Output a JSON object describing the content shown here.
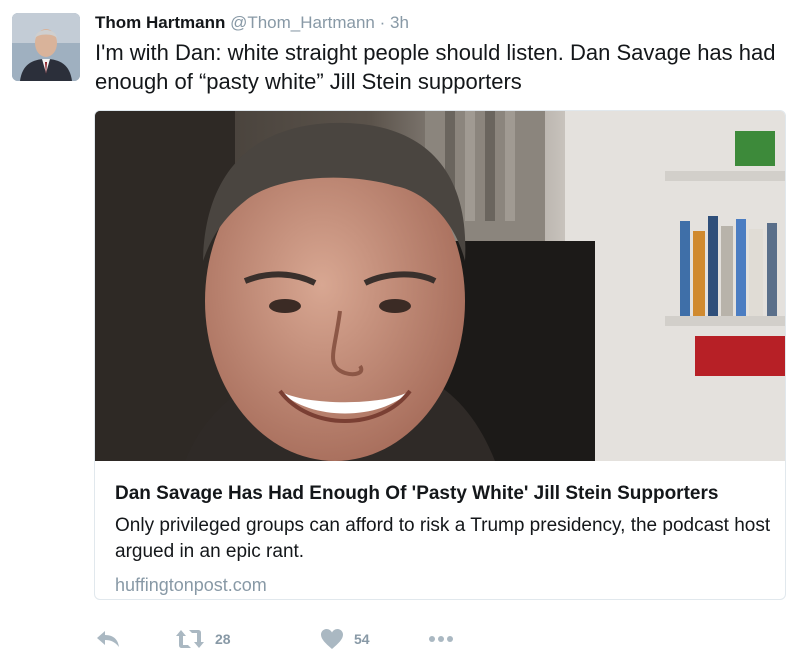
{
  "tweet": {
    "author_name": "Thom Hartmann",
    "handle": "@Thom_Hartmann",
    "separator": "·",
    "time": "3h",
    "text": "I'm with Dan: white straight people should listen. Dan Savage has had enough of “pasty white” Jill Stein supporters"
  },
  "card": {
    "title": "Dan Savage Has Had Enough Of 'Pasty White' Jill Stein Supporters",
    "description": "Only privileged groups can afford to risk a Trump presidency, the podcast host argued in an epic rant.",
    "domain": "huffingtonpost.com"
  },
  "actions": {
    "reply_icon": "reply-icon",
    "retweet_icon": "retweet-icon",
    "retweet_count": "28",
    "like_icon": "heart-icon",
    "like_count": "54",
    "more_icon": "more-icon"
  },
  "colors": {
    "text": "#14171a",
    "muted": "#8899a6",
    "border": "#e1e8ed"
  }
}
